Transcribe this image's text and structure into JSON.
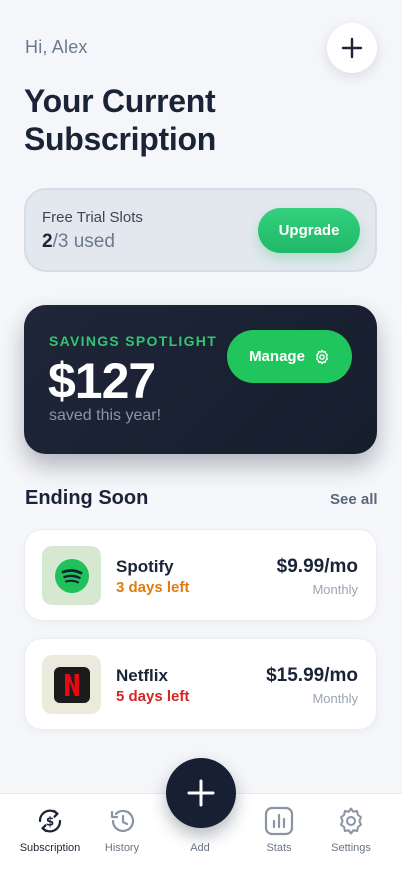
{
  "header": {
    "greeting": "Hi, Alex",
    "add_icon": "plus-icon",
    "title": "Your Current Subscription"
  },
  "trial": {
    "label": "Free Trial Slots",
    "used": "2",
    "total_text": "/3 used",
    "upgrade_label": "Upgrade"
  },
  "savings": {
    "label": "SAVINGS SPOTLIGHT",
    "amount": "$127",
    "subtitle": "saved this year!",
    "manage_label": "Manage",
    "manage_icon": "gear-icon"
  },
  "ending_soon": {
    "title": "Ending Soon",
    "see_all": "See all",
    "items": [
      {
        "name": "Spotify",
        "days_left": "3 days left",
        "price": "$9.99/mo",
        "period": "Monthly",
        "logo_icon": "spotify-logo",
        "days_color": "#e07b12",
        "logo_bg": "#d6e7d2"
      },
      {
        "name": "Netflix",
        "days_left": "5 days left",
        "price": "$15.99/mo",
        "period": "Monthly",
        "logo_icon": "netflix-logo",
        "days_color": "#d62525",
        "logo_bg": "#eceadc"
      }
    ]
  },
  "nav": {
    "items": [
      {
        "label": "Subscription",
        "icon": "subscription-icon",
        "active": true
      },
      {
        "label": "History",
        "icon": "history-icon",
        "active": false
      },
      {
        "label": "Add",
        "icon": "plus-icon",
        "active": false
      },
      {
        "label": "Stats",
        "icon": "stats-icon",
        "active": false
      },
      {
        "label": "Settings",
        "icon": "gear-icon",
        "active": false
      }
    ]
  },
  "colors": {
    "accent_green": "#21c55d",
    "dark_navy": "#172033",
    "text_dark": "#1b2436"
  }
}
